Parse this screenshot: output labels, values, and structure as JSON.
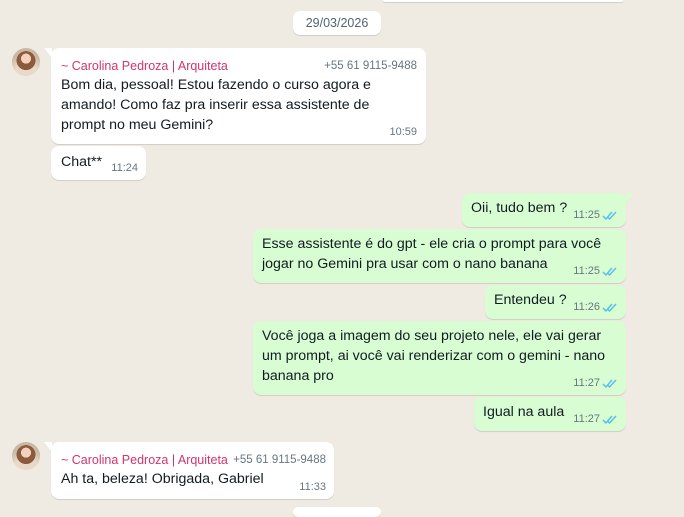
{
  "date_separator": "29/03/2026",
  "messages": [
    {
      "sender": "~ Carolina Pedroza | Arquiteta",
      "phone": "+55 61 9115-9488",
      "text_lines": [
        "Bom dia, pessoal! Estou fazendo o curso agora e",
        "amando! Como faz pra inserir essa assistente de",
        "prompt no meu Gemini?"
      ],
      "time": "10:59"
    },
    {
      "text": "Chat**",
      "time": "11:24"
    },
    {
      "text": "Oii, tudo bem ?",
      "time": "11:25"
    },
    {
      "text_lines": [
        "Esse assistente é do gpt - ele cria o prompt para você",
        "jogar no Gemini pra usar com o nano banana"
      ],
      "time": "11:25"
    },
    {
      "text": "Entendeu ?",
      "time": "11:26"
    },
    {
      "text_lines": [
        "Você joga a imagem do seu projeto nele, ele vai gerar",
        "um prompt, ai você vai renderizar com o gemini - nano",
        "banana pro"
      ],
      "time": "11:27"
    },
    {
      "text": "Igual na aula",
      "time": "11:27"
    },
    {
      "sender": "~ Carolina Pedroza | Arquiteta",
      "phone": "+55 61 9115-9488",
      "text": "Ah ta, beleza! Obrigada, Gabriel",
      "time": "11:33"
    }
  ],
  "colors": {
    "incoming": "#ffffff",
    "outgoing": "#d9fdd3",
    "sender_name": "#d1356e",
    "read_ticks": "#53bdeb",
    "background": "#efeae2"
  },
  "icons": {
    "read_receipt": "double-check-icon"
  }
}
